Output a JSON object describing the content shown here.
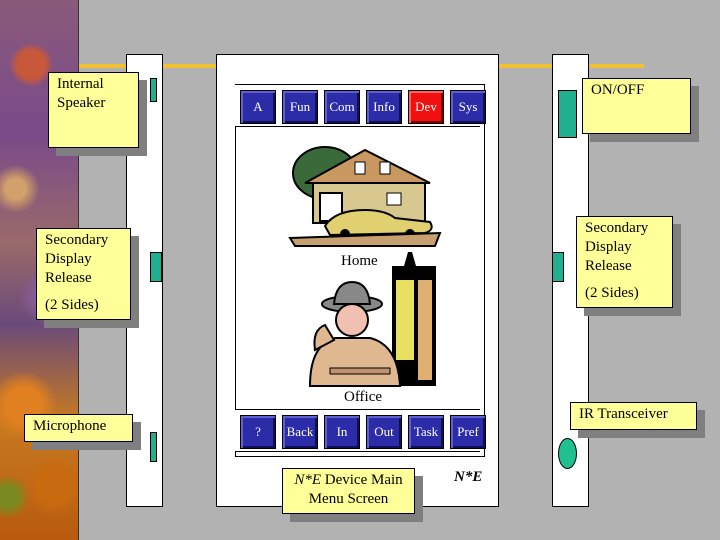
{
  "title": "N*E Device Main Menu Screen",
  "callouts": {
    "internal_speaker": [
      "Internal",
      "Speaker"
    ],
    "secondary_left": [
      "Secondary",
      "Display",
      "Release",
      "(2 Sides)"
    ],
    "microphone": "Microphone",
    "on_off": "ON/OFF",
    "secondary_right": [
      "Secondary",
      "Display",
      "Release",
      "(2 Sides)"
    ],
    "ir_transceiver": "IR Transceiver",
    "caption": {
      "brand": "N*E",
      "line1_rest": " Device Main",
      "line2": "Menu Screen"
    }
  },
  "screen": {
    "top_buttons": [
      {
        "label": "A",
        "active": false
      },
      {
        "label": "Fun",
        "active": false
      },
      {
        "label": "Com",
        "active": false
      },
      {
        "label": "Info",
        "active": false
      },
      {
        "label": "Dev",
        "active": true
      },
      {
        "label": "Sys",
        "active": false
      }
    ],
    "bottom_buttons": [
      {
        "label": "?"
      },
      {
        "label": "Back"
      },
      {
        "label": "In"
      },
      {
        "label": "Out"
      },
      {
        "label": "Task"
      },
      {
        "label": "Pref"
      }
    ],
    "home_label": "Home",
    "office_label": "Office",
    "home_icon": "house-with-car-icon",
    "office_icon": "businessman-with-skyscraper-icon",
    "brand": "N*E"
  },
  "colors": {
    "button_blue": "#2c2ca8",
    "button_active": "#f01010",
    "note_yellow": "#ffff99",
    "hardware_green": "#20b090",
    "accent_line": "#f0c030"
  }
}
